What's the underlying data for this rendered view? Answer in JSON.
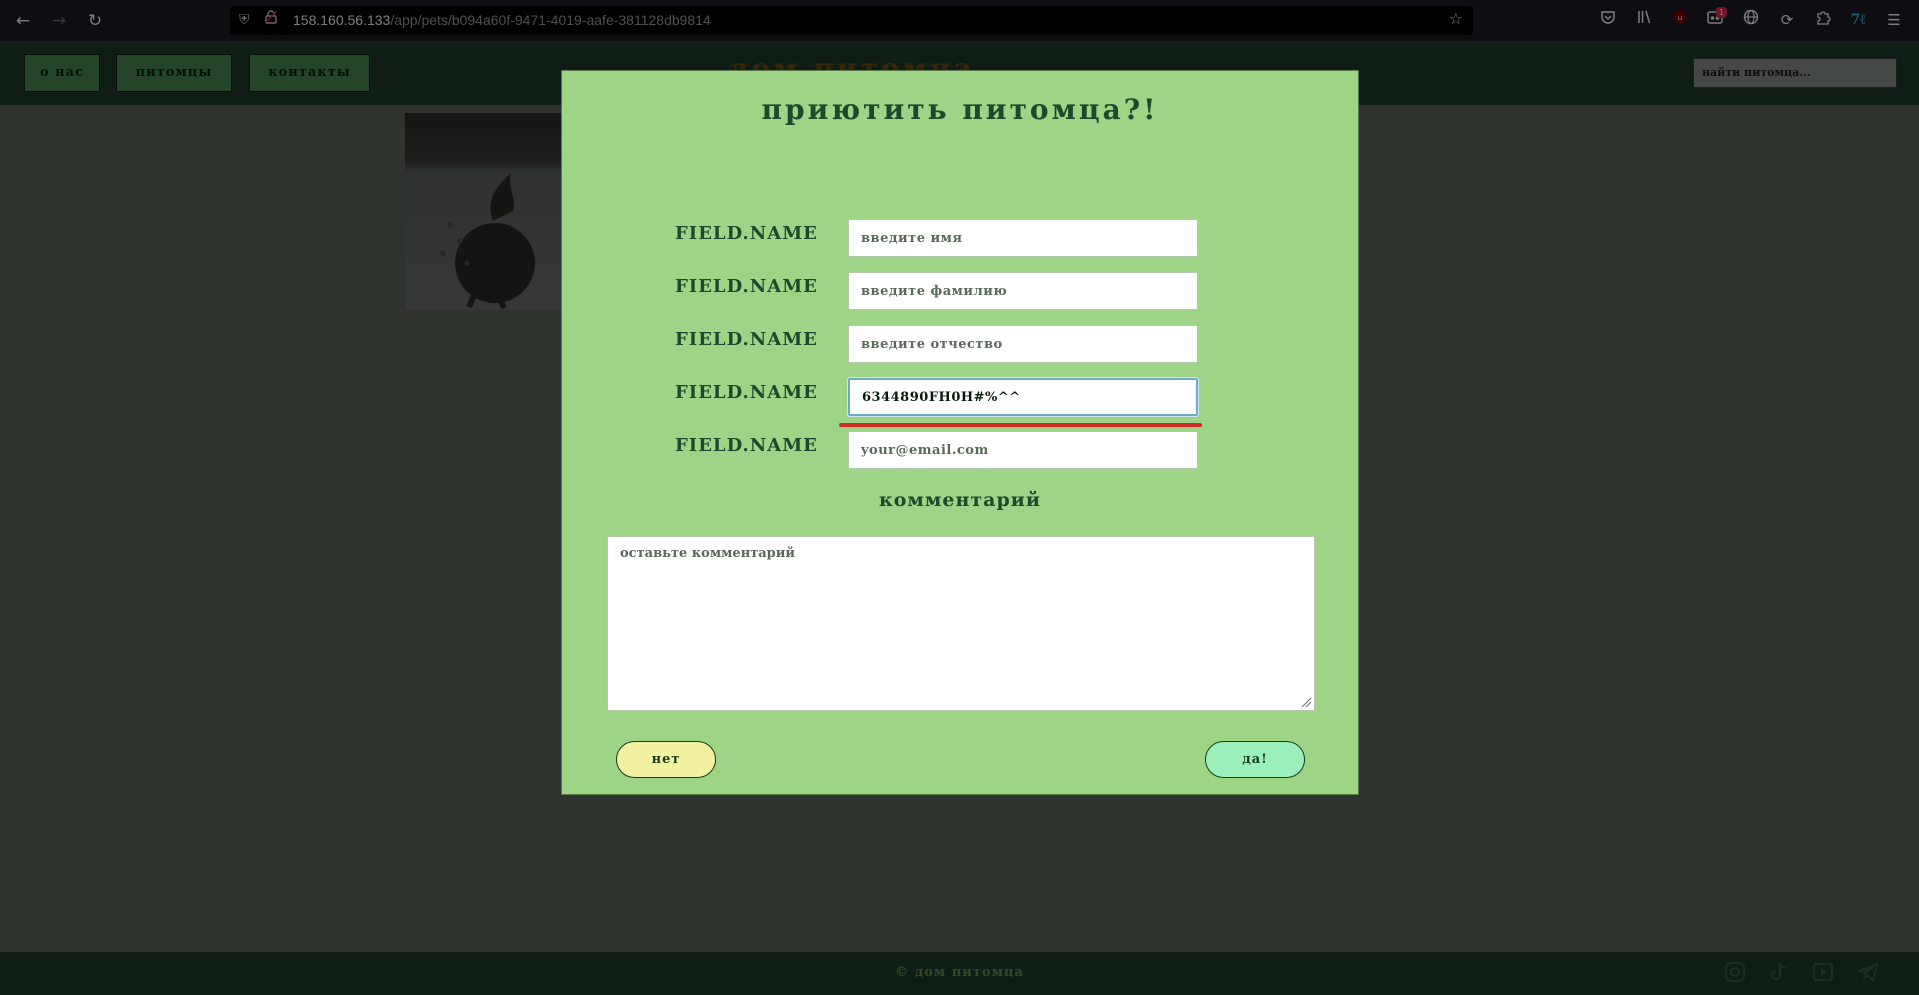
{
  "browser": {
    "url_host": "158.160.56.133",
    "url_path": "/app/pets/b094a60f-9471-4019-aafe-381128db9814",
    "extension_badge": "1",
    "icons": [
      "back-icon",
      "forward-icon",
      "reload-icon",
      "shield-icon",
      "lock-icon",
      "star-icon",
      "pocket-icon",
      "library-icon",
      "ublock-icon",
      "extension-icon",
      "globe-icon",
      "sync-icon",
      "puzzle-icon",
      "translate-icon",
      "menu-icon"
    ]
  },
  "header": {
    "nav": [
      "о нас",
      "питомцы",
      "контакты"
    ],
    "site_title": "дом питомца",
    "search_placeholder": "найти питомца..."
  },
  "modal": {
    "title": "приютить питомца?!",
    "fields": [
      {
        "label": "FIELD.NAME",
        "placeholder": "введите имя",
        "value": ""
      },
      {
        "label": "FIELD.NAME",
        "placeholder": "введите фамилию",
        "value": ""
      },
      {
        "label": "FIELD.NAME",
        "placeholder": "введите отчество",
        "value": ""
      },
      {
        "label": "FIELD.NAME",
        "placeholder": "",
        "value": "6344890FH0H#%^^"
      },
      {
        "label": "FIELD.NAME",
        "placeholder": "your@email.com",
        "value": ""
      }
    ],
    "comment_heading": "комментарий",
    "comment_placeholder": "оставьте комментарий",
    "no_label": "нет",
    "yes_label": "да!"
  },
  "footer": {
    "copyright": "© дом питомца",
    "social_icons": [
      "instagram-icon",
      "tiktok-icon",
      "youtube-icon",
      "telegram-icon"
    ]
  },
  "colors": {
    "modal_bg": "#9dd486",
    "title_green": "#1d4a2c",
    "header_bg": "#1e3a29",
    "error_red": "#d42a2a",
    "btn_no": "#f3f2a0",
    "btn_yes": "#9af0bb"
  }
}
